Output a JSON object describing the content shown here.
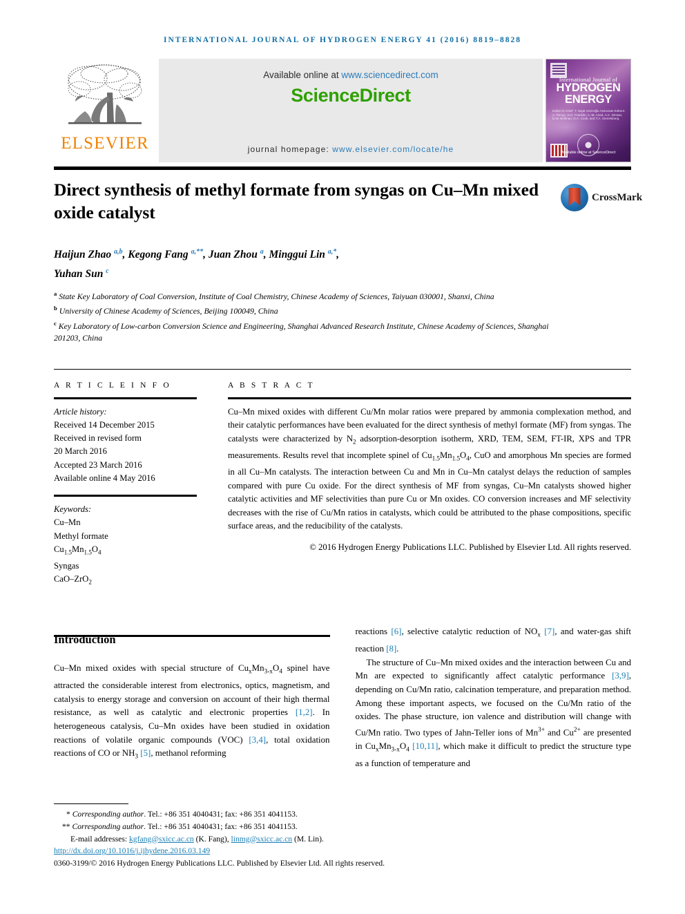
{
  "running_head": "INTERNATIONAL JOURNAL OF HYDROGEN ENERGY 41 (2016) 8819–8828",
  "masthead": {
    "publisher_name": "ELSEVIER",
    "available_prefix": "Available online at ",
    "available_link": "www.sciencedirect.com",
    "sciencedirect_logo": "ScienceDirect",
    "homepage_prefix": "journal homepage: ",
    "homepage_link": "www.elsevier.com/locate/he",
    "cover": {
      "line1": "International Journal of",
      "line2": "HYDROGEN",
      "line3": "ENERGY",
      "editors": "Editor-in-Chief: T. Nejat Veziroğlu   Associate Editors: A. Perujo, D.G. Franklin, A.-M. Azad, A.C. Dimian, D.W. Bellman, D.A. Cook, and T.A. Semelsberg",
      "footer": "Available online at ScienceDirect"
    },
    "colors": {
      "sciencedirect_green": "#2ea000",
      "elsevier_orange": "#ef8200",
      "link_blue": "#2b7bb9",
      "running_head_blue": "#0f6ea6"
    }
  },
  "article": {
    "title": "Direct synthesis of methyl formate from syngas on Cu–Mn mixed oxide catalyst",
    "crossmark_label": "CrossMark",
    "authors_line1_a": "Haijun Zhao ",
    "authors_line1_a_sup": "a,b",
    "authors_line1_b": ", Kegong Fang ",
    "authors_line1_b_sup": "a,**",
    "authors_line1_c": ", Juan Zhou ",
    "authors_line1_c_sup": "a",
    "authors_line1_d": ", Minggui Lin ",
    "authors_line1_d_sup": "a,*",
    "authors_line1_e": ",",
    "authors_line2": "Yuhan Sun ",
    "authors_line2_sup": "c",
    "affiliations": [
      {
        "mark": "a",
        "text": "State Key Laboratory of Coal Conversion, Institute of Coal Chemistry, Chinese Academy of Sciences, Taiyuan 030001, Shanxi, China"
      },
      {
        "mark": "b",
        "text": "University of Chinese Academy of Sciences, Beijing 100049, China"
      },
      {
        "mark": "c",
        "text": "Key Laboratory of Low-carbon Conversion Science and Engineering, Shanghai Advanced Research Institute, Chinese Academy of Sciences, Shanghai 201203, China"
      }
    ]
  },
  "article_info": {
    "heading": "A R T I C L E   I N F O",
    "history_label": "Article history:",
    "history": [
      "Received 14 December 2015",
      "Received in revised form",
      "20 March 2016",
      "Accepted 23 March 2016",
      "Available online 4 May 2016"
    ],
    "keywords_label": "Keywords:",
    "keywords": [
      "Cu–Mn",
      "Methyl formate",
      "Cu1.5Mn1.5O4",
      "Syngas",
      "CaO–ZrO2"
    ]
  },
  "abstract": {
    "heading": "A B S T R A C T",
    "p1_seg1": "Cu–Mn mixed oxides with different Cu/Mn molar ratios were prepared by ammonia complexation method, and their catalytic performances have been evaluated for the direct synthesis of methyl formate (MF) from syngas. The catalysts were characterized by N",
    "p1_sub1": "2",
    "p1_seg2": " adsorption-desorption isotherm, XRD, TEM, SEM, FT-IR, XPS and TPR measurements. Results revel that incomplete spinel of Cu",
    "p1_sub2": "1.5",
    "p1_seg3": "Mn",
    "p1_sub3": "1.5",
    "p1_seg4": "O",
    "p1_sub4": "4",
    "p1_seg5": ", CuO and amorphous Mn species are formed in all Cu–Mn catalysts. The interaction between Cu and Mn in Cu–Mn catalyst delays the reduction of samples compared with pure Cu oxide. For the direct synthesis of MF from syngas, Cu–Mn catalysts showed higher catalytic activities and MF selectivities than pure Cu or Mn oxides. CO conversion increases and MF selectivity decreases with the rise of Cu/Mn ratios in catalysts, which could be attributed to the phase compositions, specific surface areas, and the reducibility of the catalysts.",
    "copyright": "© 2016 Hydrogen Energy Publications LLC. Published by Elsevier Ltd. All rights reserved."
  },
  "introduction": {
    "heading": "Introduction",
    "left_p1_seg1": "Cu–Mn mixed oxides with special structure of Cu",
    "left_p1_sub1": "x",
    "left_p1_seg2": "Mn",
    "left_p1_sub2": "3-x",
    "left_p1_seg3": "O",
    "left_p1_sub3": "4",
    "left_p1_seg4": " spinel have attracted the considerable interest from electronics, optics, magnetism, and catalysis to energy storage and conversion on account of their high thermal resistance, as well as catalytic and electronic properties ",
    "left_p1_cite1": "[1,2]",
    "left_p1_seg5": ". In heterogeneous catalysis, Cu–Mn oxides have been studied in oxidation reactions of volatile organic compounds (VOC) ",
    "left_p1_cite2": "[3,4]",
    "left_p1_seg6": ", total oxidation reactions of CO or NH",
    "left_p1_sub4": "3",
    "left_p1_seg7": " ",
    "left_p1_cite3": "[5]",
    "left_p1_seg8": ", methanol reforming",
    "right_p1_seg1": "reactions ",
    "right_p1_cite1": "[6]",
    "right_p1_seg2": ", selective catalytic reduction of NO",
    "right_p1_sub1": "x",
    "right_p1_seg3": " ",
    "right_p1_cite2": "[7]",
    "right_p1_seg4": ", and water-gas shift reaction ",
    "right_p1_cite3": "[8]",
    "right_p1_seg5": ".",
    "right_p2_seg1": "The structure of Cu–Mn mixed oxides and the interaction between Cu and Mn are expected to significantly affect catalytic performance ",
    "right_p2_cite1": "[3,9]",
    "right_p2_seg2": ", depending on Cu/Mn ratio, calcination temperature, and preparation method. Among these important aspects, we focused on the Cu/Mn ratio of the oxides. The phase structure, ion valence and distribution will change with Cu/Mn ratio. Two types of Jahn-Teller ions of Mn",
    "right_p2_sup1": "3+",
    "right_p2_seg3": " and Cu",
    "right_p2_sup2": "2+",
    "right_p2_seg4": " are presented in Cu",
    "right_p2_sub1": "x",
    "right_p2_seg5": "Mn",
    "right_p2_sub2": "3-x",
    "right_p2_seg6": "O",
    "right_p2_sub3": "4",
    "right_p2_seg7": " ",
    "right_p2_cite2": "[10,11]",
    "right_p2_seg8": ", which make it difficult to predict the structure type as a function of temperature and"
  },
  "footnotes": {
    "star1_mark": "*",
    "star1_text": "Corresponding author. Tel.: +86 351 4040431; fax: +86 351 4041153.",
    "star2_mark": "**",
    "star2_text": "Corresponding author. Tel.: +86 351 4040431; fax: +86 351 4041153.",
    "email_label": "E-mail addresses: ",
    "email1": "kgfang@sxicc.ac.cn",
    "email1_owner": " (K. Fang), ",
    "email2": "linmg@sxicc.ac.cn",
    "email2_owner": " (M. Lin).",
    "doi": "http://dx.doi.org/10.1016/j.ijhydene.2016.03.149",
    "issn_line": "0360-3199/© 2016 Hydrogen Energy Publications LLC. Published by Elsevier Ltd. All rights reserved."
  }
}
